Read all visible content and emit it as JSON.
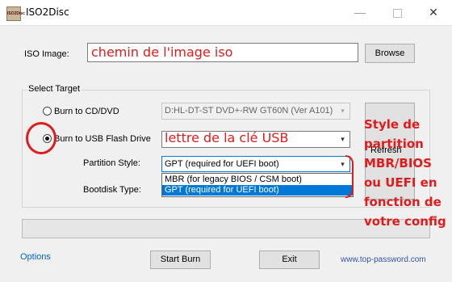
{
  "window": {
    "title": "ISO2Disc",
    "icon_text": "ISO2Disc",
    "min_glyph": "—",
    "close_glyph": "✕"
  },
  "iso": {
    "label": "ISO Image:",
    "value": "chemin de l'image iso",
    "browse_label": "Browse"
  },
  "target": {
    "group_title": "Select Target",
    "cd_label": "Burn to CD/DVD",
    "cd_drive": "D:HL-DT-ST DVD+-RW GT60N (Ver A101)",
    "usb_label": "Burn to USB Flash Drive",
    "usb_value": "lettre de la clé USB",
    "selected": "usb",
    "partition_label": "Partition Style:",
    "partition_value": "GPT (required for UEFI boot)",
    "partition_options": [
      "MBR (for legacy BIOS / CSM boot)",
      "GPT (required for UEFI boot)"
    ],
    "partition_selected_index": 1,
    "bootdisk_label": "Bootdisk Type:",
    "refresh_label": "Refresh"
  },
  "progress": {
    "fraction": 0
  },
  "footer": {
    "options_label": "Options",
    "start_label": "Start Burn",
    "exit_label": "Exit",
    "watermark": "www.top-password.com"
  },
  "annotation": {
    "side_text": "Style de partition MBR/BIOS ou UEFI en fonction de votre config",
    "color": "#e11b1b"
  },
  "icons": {
    "dropdown_arrow": "▾"
  }
}
